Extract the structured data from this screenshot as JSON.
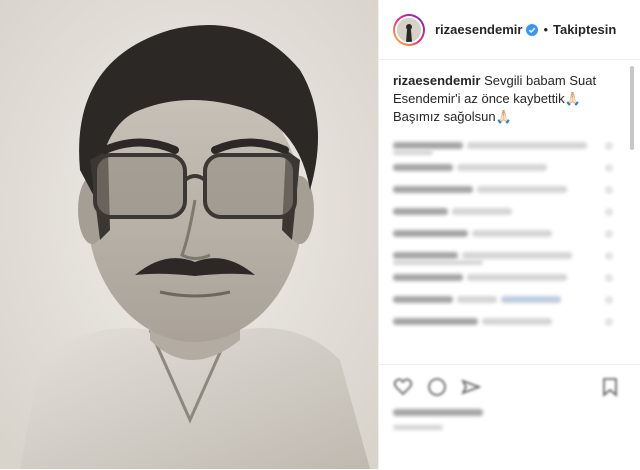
{
  "post": {
    "username": "rizaesendemir",
    "follow_status": "Takiptesin",
    "caption_user": "rizaesendemir",
    "caption_text": "Sevgili babam Suat Esendemir'i az önce kaybettik🙏🏻 Başımız sağolsun🙏🏻"
  },
  "icons": {
    "verified": "verified-badge-icon",
    "like": "heart-icon",
    "comment": "comment-icon",
    "share": "share-icon",
    "save": "bookmark-icon"
  },
  "colors": {
    "text": "#262626",
    "verified": "#3897f0",
    "border": "#efefef"
  }
}
